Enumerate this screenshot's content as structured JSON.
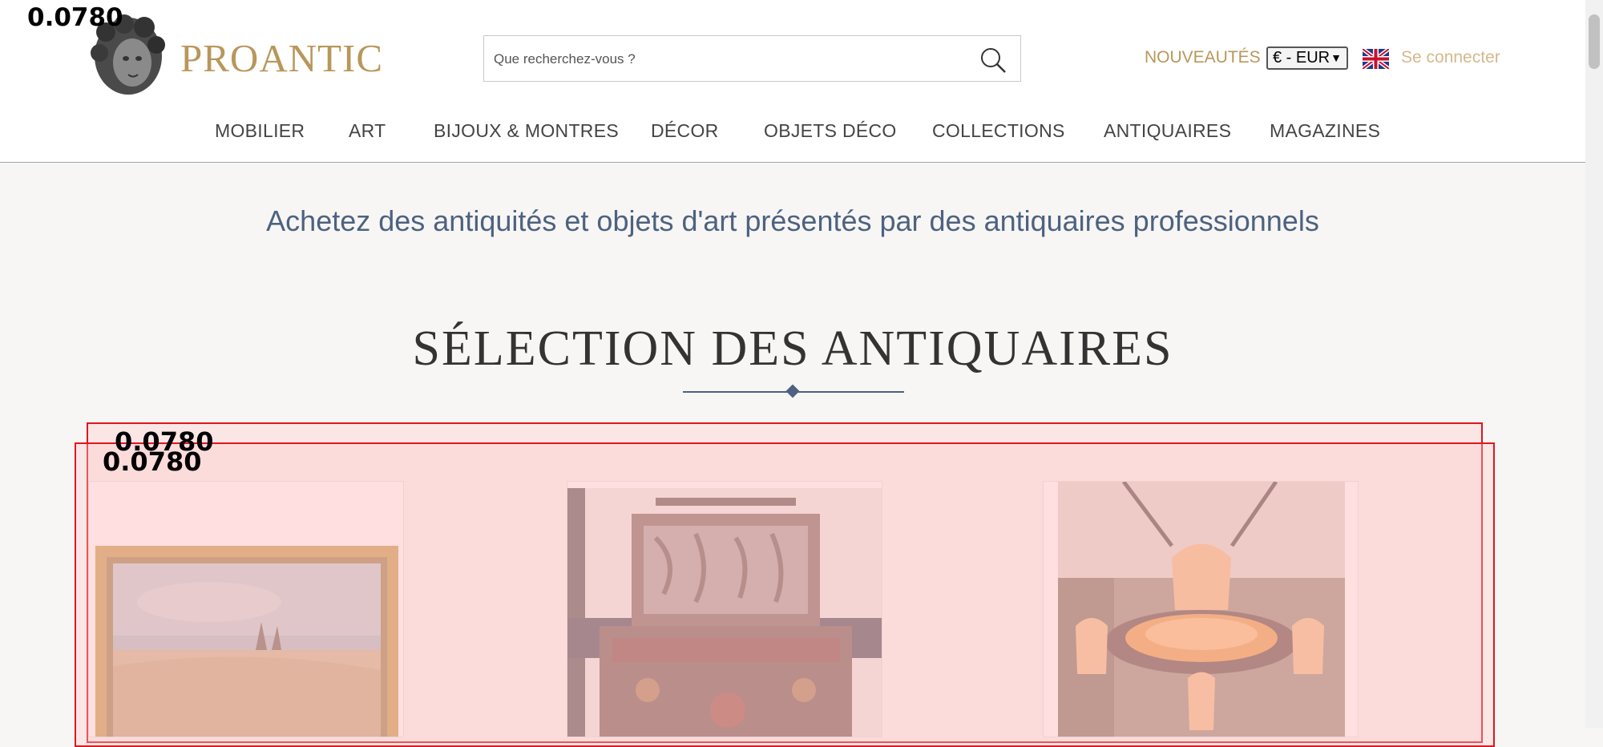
{
  "overlay_scores": {
    "top": "0.0780",
    "box1": "0.0780",
    "box2": "0.0780"
  },
  "header": {
    "brand": "PROANTIC",
    "search_placeholder": "Que recherchez-vous ?",
    "nouveautes": "NOUVEAUTÉS",
    "currency": "€ - EUR",
    "login": "Se connecter"
  },
  "nav": [
    "MOBILIER",
    "ART",
    "BIJOUX & MONTRES",
    "DÉCOR",
    "OBJETS DÉCO",
    "COLLECTIONS",
    "ANTIQUAIRES",
    "MAGAZINES"
  ],
  "tagline": "Achetez des antiquités et objets d'art présentés par des antiquaires professionnels",
  "section_title": "SÉLECTION DES ANTIQUAIRES",
  "colors": {
    "gold": "#b8975a",
    "slate": "#4d6280",
    "overlay_red": "#e0161d"
  },
  "icons": {
    "search": "search-icon",
    "flag": "uk-flag-icon",
    "logo": "sculpted-head-logo"
  }
}
